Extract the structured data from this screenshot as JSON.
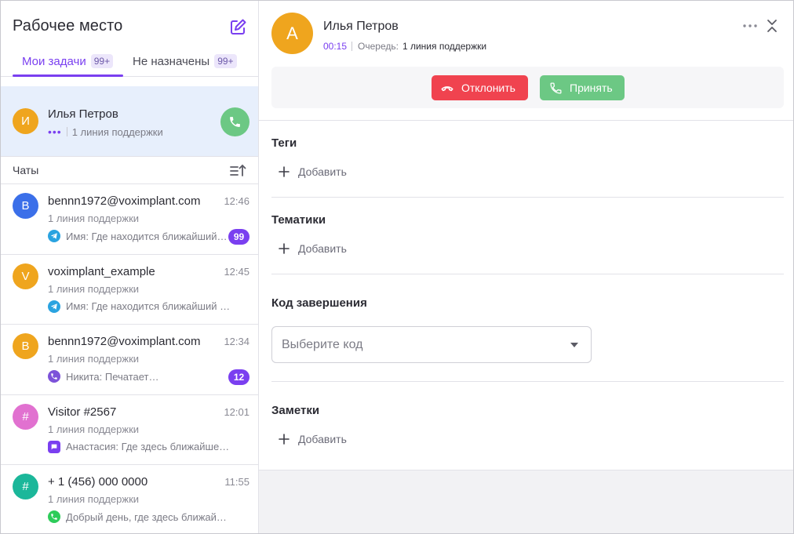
{
  "sidebar": {
    "title": "Рабочее место",
    "tabs": [
      {
        "label": "Мои задачи",
        "count": "99+"
      },
      {
        "label": "Не назначены",
        "count": "99+"
      }
    ],
    "active_call": {
      "initial": "И",
      "name": "Илья Петров",
      "line": "1 линия поддержки"
    },
    "chats_label": "Чаты",
    "chats": [
      {
        "initial": "B",
        "avatar_color": "#3b6fe9",
        "name": "bennn1972@voximplant.com",
        "time": "12:46",
        "line": "1 линия поддержки",
        "channel": "telegram-icon",
        "channel_color": "#2aa3e0",
        "message": "Имя: Где находится ближайший…",
        "badge": "99"
      },
      {
        "initial": "V",
        "avatar_color": "#efa51e",
        "name": "voximplant_example",
        "time": "12:45",
        "line": "1 линия поддержки",
        "channel": "telegram-icon",
        "channel_color": "#2aa3e0",
        "message": "Имя: Где находится ближайший отде…",
        "badge": ""
      },
      {
        "initial": "B",
        "avatar_color": "#efa51e",
        "name": "bennn1972@voximplant.com",
        "time": "12:34",
        "line": "1 линия поддержки",
        "channel": "viber-icon",
        "channel_color": "#7d52d9",
        "message": "Никита: Печатает…",
        "badge": "12"
      },
      {
        "initial": "#",
        "avatar_color": "#e171d0",
        "name": "Visitor #2567",
        "time": "12:01",
        "line": "1 линия поддержки",
        "channel": "chat-bubble-icon",
        "channel_color": "#7a3ff0",
        "message": "Анастасия: Где здесь ближайшее…",
        "badge": ""
      },
      {
        "initial": "#",
        "avatar_color": "#1bb79a",
        "name": "+ 1 (456) 000 0000",
        "time": "11:55",
        "line": "1 линия поддержки",
        "channel": "whatsapp-icon",
        "channel_color": "#2ecc5a",
        "message": "Добрый день, где здесь ближайшее…",
        "badge": ""
      }
    ]
  },
  "call": {
    "initial": "А",
    "name": "Илья Петров",
    "timer": "00:15",
    "queue_label": "Очередь:",
    "queue_value": "1 линия поддержки",
    "reject_label": "Отклонить",
    "accept_label": "Принять"
  },
  "sections": {
    "tags_title": "Теги",
    "topics_title": "Тематики",
    "code_title": "Код завершения",
    "code_placeholder": "Выберите код",
    "notes_title": "Заметки",
    "add_label": "Добавить"
  },
  "colors": {
    "accent": "#7a3ff0",
    "reject": "#f0434f",
    "accept": "#6cc884",
    "active_row": "#e7effc"
  }
}
